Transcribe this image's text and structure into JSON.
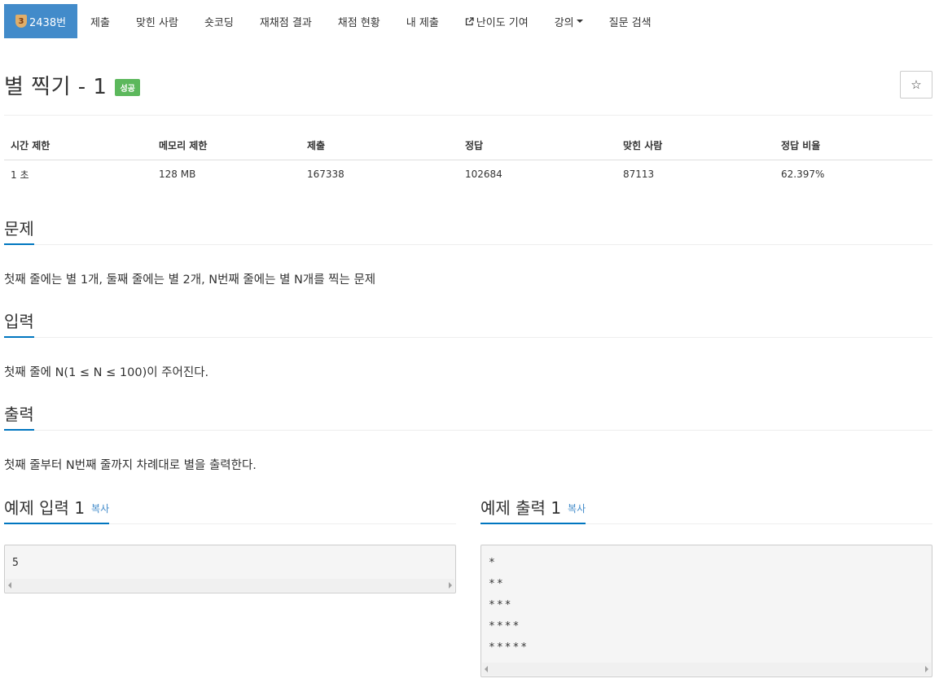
{
  "nav": {
    "problem_tier": "3",
    "problem_number": "2438번",
    "tabs": [
      "제출",
      "맞힌 사람",
      "숏코딩",
      "재채점 결과",
      "채점 현황",
      "내 제출",
      "난이도 기여",
      "강의",
      "질문 검색"
    ]
  },
  "problem": {
    "title": "별 찍기 - 1",
    "status": "성공",
    "star_icon": "☆"
  },
  "info": {
    "headers": [
      "시간 제한",
      "메모리 제한",
      "제출",
      "정답",
      "맞힌 사람",
      "정답 비율"
    ],
    "values": [
      "1 초",
      "128 MB",
      "167338",
      "102684",
      "87113",
      "62.397%"
    ]
  },
  "sections": {
    "description_heading": "문제",
    "description_text": "첫째 줄에는 별 1개, 둘째 줄에는 별 2개, N번째 줄에는 별 N개를 찍는 문제",
    "input_heading": "입력",
    "input_text": "첫째 줄에 N(1 ≤ N ≤ 100)이 주어진다.",
    "output_heading": "출력",
    "output_text": "첫째 줄부터 N번째 줄까지 차례대로 별을 출력한다."
  },
  "samples": {
    "copy_label": "복사",
    "input_heading": "예제 입력 1",
    "input_lines": [
      "5"
    ],
    "output_heading": "예제 출력 1",
    "output_lines": [
      "*",
      "**",
      "***",
      "****",
      "*****"
    ]
  },
  "colors": {
    "accent": "#428bca",
    "success": "#5cb85c",
    "heading_underline": "#0076c0"
  }
}
